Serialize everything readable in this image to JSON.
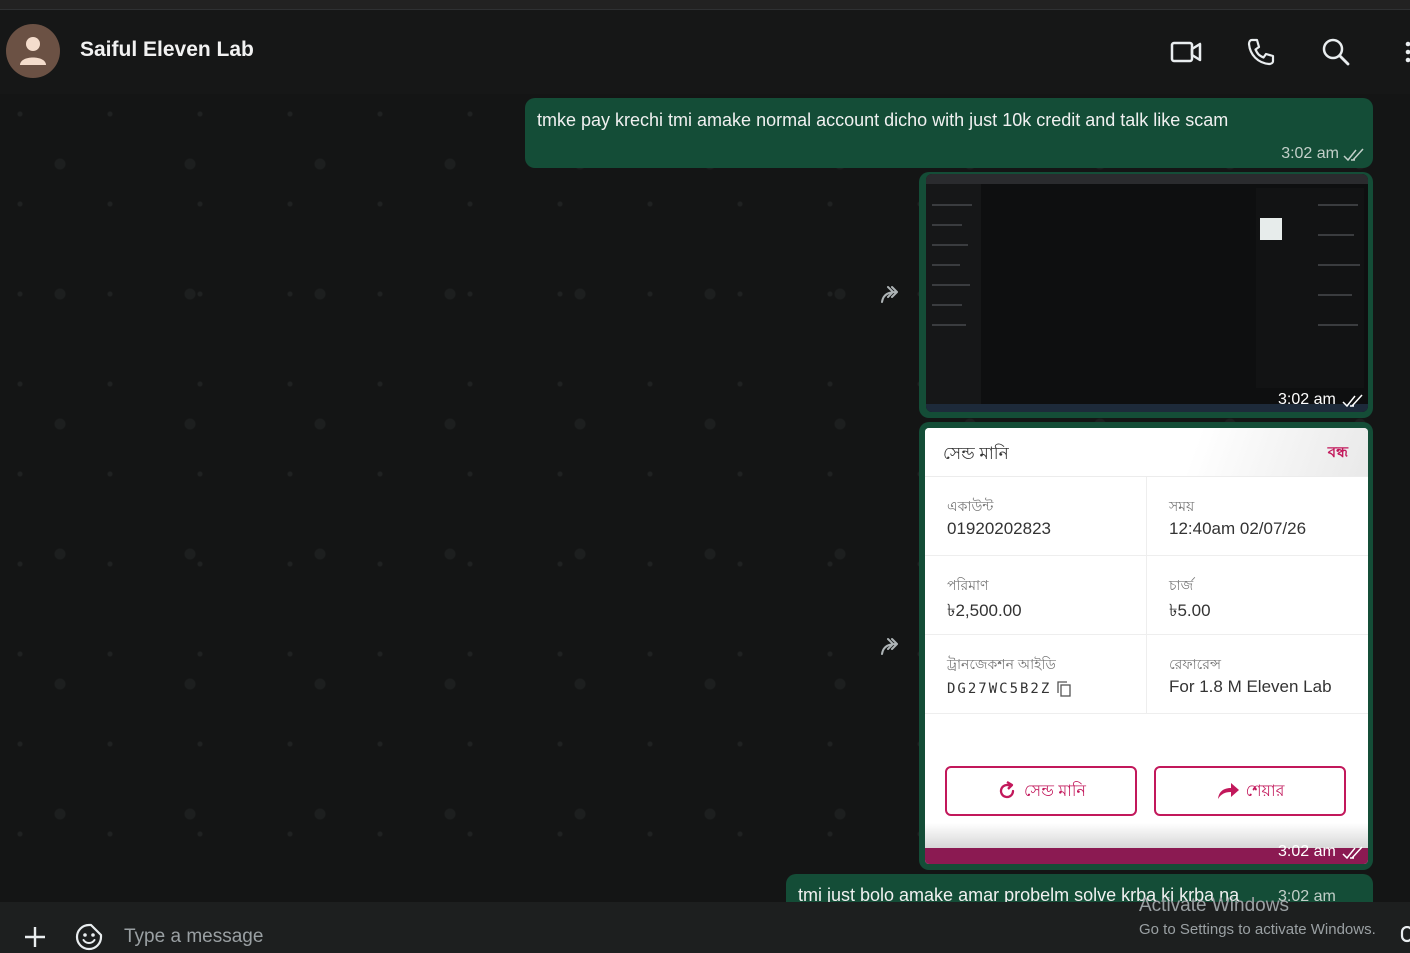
{
  "header": {
    "contact_name": "Saiful Eleven Lab",
    "icons": [
      "video-call-icon",
      "voice-call-icon",
      "search-icon",
      "menu-icon"
    ]
  },
  "messages": [
    {
      "text": "tmke pay krechi tmi amake normal account dicho with just 10k credit and talk like scam",
      "time": "3:02 am"
    },
    {
      "type": "image",
      "time": "3:02 am"
    },
    {
      "type": "receipt",
      "time": "3:02 am"
    },
    {
      "text": "tmi just bolo amake amar probelm solve krba ki krba na",
      "time": "3:02 am"
    }
  ],
  "receipt": {
    "title": "সেন্ড মানি",
    "close": "বন্ধ",
    "account_label": "একাউন্ট",
    "account_value": "01920202823",
    "time_label": "সময়",
    "time_value": "12:40am 02/07/26",
    "amount_label": "পরিমাণ",
    "amount_value": "৳2,500.00",
    "charge_label": "চার্জ",
    "charge_value": "৳5.00",
    "trxid_label": "ট্রানজেকশন আইডি",
    "trxid_value": "DG27WC5B2Z",
    "reference_label": "রেফারেন্স",
    "reference_value": "For 1.8 M Eleven Lab",
    "send_again_label": "সেন্ড মানি",
    "share_label": "শেয়ার"
  },
  "composer": {
    "placeholder": "Type a message"
  },
  "watermark": {
    "line1": "Activate Windows",
    "line2": "Go to Settings to activate Windows."
  },
  "colors": {
    "outgoing_bubble": "#144d37",
    "accent_pink": "#c2185b",
    "background": "#161717"
  }
}
